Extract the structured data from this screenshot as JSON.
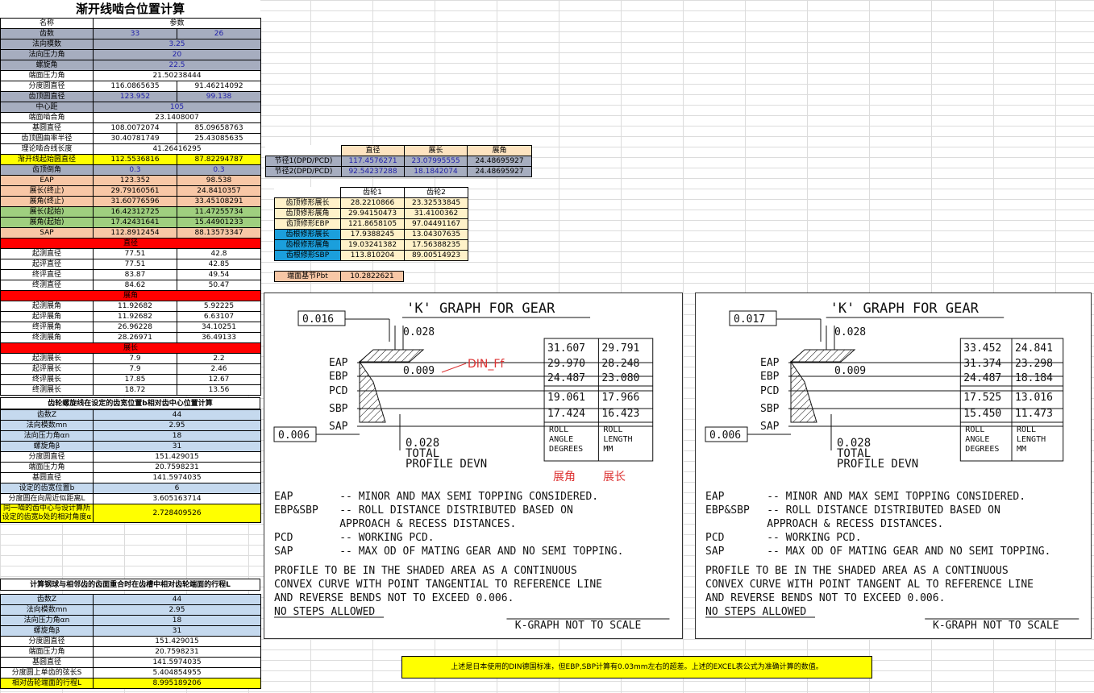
{
  "title": "渐开线啮合位置计算",
  "main_header": [
    "名称",
    "参数"
  ],
  "main_rows": [
    {
      "label": "齿数",
      "a": "33",
      "b": "26",
      "span": false,
      "style": "gray"
    },
    {
      "label": "法向模数",
      "v": "3.25",
      "span": true,
      "style": "gray"
    },
    {
      "label": "法向压力角",
      "v": "20",
      "span": true,
      "style": "gray"
    },
    {
      "label": "螺旋角",
      "v": "22.5",
      "span": true,
      "style": "gray"
    },
    {
      "label": "端面压力角",
      "v": "21.50238444",
      "span": true,
      "style": "white"
    },
    {
      "label": "分度圆直径",
      "a": "116.0865635",
      "b": "91.46214092",
      "span": false,
      "style": "white"
    },
    {
      "label": "齿顶圆直径",
      "a": "123.952",
      "b": "99.138",
      "span": false,
      "style": "gray"
    },
    {
      "label": "中心距",
      "v": "105",
      "span": true,
      "style": "gray"
    },
    {
      "label": "端面啮合角",
      "v": "23.1408007",
      "span": true,
      "style": "white"
    },
    {
      "label": "基圆直径",
      "a": "108.0072074",
      "b": "85.09658763",
      "span": false,
      "style": "white"
    },
    {
      "label": "齿顶圆曲率半径",
      "a": "30.40781749",
      "b": "25.43085635",
      "span": false,
      "style": "white"
    },
    {
      "label": "理论啮合线长度",
      "v": "41.26416295",
      "span": true,
      "style": "white"
    },
    {
      "label": "渐开线起始圆直径",
      "a": "112.5536816",
      "b": "87.82294787",
      "span": false,
      "style": "yellow"
    },
    {
      "label": "齿顶倒角",
      "a": "0.3",
      "b": "0.3",
      "span": false,
      "style": "gray"
    },
    {
      "label": "EAP",
      "a": "123.352",
      "b": "98.538",
      "span": false,
      "style": "orange"
    },
    {
      "label": "展长(终止)",
      "a": "29.79160561",
      "b": "24.8410357",
      "span": false,
      "style": "orange"
    },
    {
      "label": "展角(终止)",
      "a": "31.60776596",
      "b": "33.45108291",
      "span": false,
      "style": "orange"
    },
    {
      "label": "展长(起始)",
      "a": "16.42312725",
      "b": "11.47255734",
      "span": false,
      "style": "green"
    },
    {
      "label": "展角(起始)",
      "a": "17.42431641",
      "b": "15.44901233",
      "span": false,
      "style": "green"
    },
    {
      "label": "SAP",
      "a": "112.8912454",
      "b": "88.13573347",
      "span": false,
      "style": "orange"
    }
  ],
  "diameter_section": {
    "header": "直径",
    "rows": [
      {
        "label": "起测直径",
        "a": "77.51",
        "b": "42.8"
      },
      {
        "label": "起评直径",
        "a": "77.51",
        "b": "42.85"
      },
      {
        "label": "终评直径",
        "a": "83.87",
        "b": "49.54"
      },
      {
        "label": "终测直径",
        "a": "84.62",
        "b": "50.47"
      }
    ]
  },
  "angle_section": {
    "header": "展角",
    "rows": [
      {
        "label": "起测展角",
        "a": "11.92682",
        "b": "5.92225"
      },
      {
        "label": "起评展角",
        "a": "11.92682",
        "b": "6.63107"
      },
      {
        "label": "终评展角",
        "a": "26.96228",
        "b": "34.10251"
      },
      {
        "label": "终测展角",
        "a": "28.26971",
        "b": "36.49133"
      }
    ]
  },
  "length_section": {
    "header": "展长",
    "rows": [
      {
        "label": "起测展长",
        "a": "7.9",
        "b": "2.2"
      },
      {
        "label": "起评展长",
        "a": "7.9",
        "b": "2.46"
      },
      {
        "label": "终评展长",
        "a": "17.85",
        "b": "12.67"
      },
      {
        "label": "终测展长",
        "a": "18.72",
        "b": "13.56"
      }
    ]
  },
  "helix_section": {
    "title": "齿轮螺旋线在设定的齿宽位置b相对齿中心位置计算",
    "rows": [
      {
        "label": "齿数Z",
        "v": "44",
        "style": "blue"
      },
      {
        "label": "法向模数mn",
        "v": "2.95",
        "style": "blue"
      },
      {
        "label": "法向压力角αn",
        "v": "18",
        "style": "blue"
      },
      {
        "label": "螺旋角β",
        "v": "31",
        "style": "blue"
      },
      {
        "label": "分度圆直径",
        "v": "151.429015",
        "style": "white"
      },
      {
        "label": "端面压力角",
        "v": "20.7598231",
        "style": "white"
      },
      {
        "label": "基圆直径",
        "v": "141.5974035",
        "style": "white"
      },
      {
        "label": "设定的齿宽位置b",
        "v": "6",
        "style": "blue"
      },
      {
        "label": "分度圆在向周近似距离L",
        "v": "3.605163714",
        "style": "white"
      },
      {
        "label": "同一啮的齿中心与设计算所设定的齿宽b处的相对角度α",
        "v": "2.728409526",
        "style": "yellow"
      }
    ]
  },
  "travel_section": {
    "title": "计算钢球与相邻齿的齿面重合时在齿槽中相对齿轮端面的行程L",
    "rows": [
      {
        "label": "齿数Z",
        "v": "44",
        "style": "blue"
      },
      {
        "label": "法向模数mn",
        "v": "2.95",
        "style": "blue"
      },
      {
        "label": "法向压力角αn",
        "v": "18",
        "style": "blue"
      },
      {
        "label": "螺旋角β",
        "v": "31",
        "style": "blue"
      },
      {
        "label": "分度圆直径",
        "v": "151.429015",
        "style": "white"
      },
      {
        "label": "端面压力角",
        "v": "20.7598231",
        "style": "white"
      },
      {
        "label": "基圆直径",
        "v": "141.5974035",
        "style": "white"
      },
      {
        "label": "分度圆上单齿的弦长S",
        "v": "5.404854955",
        "style": "white"
      },
      {
        "label": "相对齿轮端面的行程L",
        "v": "8.995189206",
        "style": "yellow"
      }
    ]
  },
  "pitch_table": {
    "headers": [
      "",
      "直径",
      "展长",
      "展角"
    ],
    "rows": [
      {
        "label": "节径1(DPD/PCD)",
        "d": "117.4576271",
        "l": "23.07995555",
        "a": "24.48695927"
      },
      {
        "label": "节径2(DPD/PCD)",
        "d": "92.54237288",
        "l": "18.1842074",
        "a": "24.48695927"
      }
    ]
  },
  "mod_table": {
    "headers": [
      "",
      "齿轮1",
      "齿轮2"
    ],
    "rows": [
      {
        "label": "齿顶修形展长",
        "a": "28.2210866",
        "b": "23.32533845",
        "style": "pale"
      },
      {
        "label": "齿顶修形展角",
        "a": "29.94150473",
        "b": "31.4100362",
        "style": "pale"
      },
      {
        "label": "齿顶修形EBP",
        "a": "121.8658105",
        "b": "97.04491167",
        "style": "pale"
      },
      {
        "label": "齿根修形展长",
        "a": "17.9388245",
        "b": "13.04307635",
        "style": "cyan"
      },
      {
        "label": "齿根修形展角",
        "a": "19.03241382",
        "b": "17.56388235",
        "style": "cyan"
      },
      {
        "label": "齿根修形SBP",
        "a": "113.810204",
        "b": "89.00514923",
        "style": "cyan"
      }
    ]
  },
  "pbt": {
    "label": "端面基节Pbt",
    "v": "10.2822621"
  },
  "drawing1": {
    "title": "'K' GRAPH FOR GEAR",
    "tol_top": "0.016",
    "tol_028": "0.028",
    "tol_009": "0.009",
    "tol_bottom": "0.006",
    "din_label": "DIN_Ff",
    "points": [
      "EAP",
      "EBP",
      "PCD",
      "SBP",
      "SAP"
    ],
    "angles": [
      "31.607",
      "29.970",
      "24.487",
      "19.061",
      "17.424"
    ],
    "lengths": [
      "29.791",
      "28.248",
      "23.080",
      "17.966",
      "16.423"
    ],
    "col1_caption": [
      "ROLL",
      "ANGLE",
      "DEGREES"
    ],
    "col2_caption": [
      "ROLL",
      "LENGTH",
      "MM"
    ],
    "total_label": [
      "0.028",
      "TOTAL",
      "PROFILE DEVN"
    ],
    "cn_angle": "展角",
    "cn_length": "展长",
    "notes": [
      [
        "EAP",
        "-- MINOR AND MAX SEMI TOPPING CONSIDERED."
      ],
      [
        "EBP&SBP",
        "-- ROLL DISTANCE DISTRIBUTED BASED ON"
      ],
      [
        "",
        "APPROACH & RECESS DISTANCES."
      ],
      [
        "PCD",
        "-- WORKING PCD."
      ],
      [
        "SAP",
        "-- MAX OD OF MATING GEAR AND NO SEMI TOPPING."
      ]
    ],
    "profile_text": [
      "PROFILE TO BE IN THE SHADED AREA AS A CONTINUOUS",
      "CONVEX CURVE WITH POINT TANGENTIAL TO REFERENCE LINE",
      "AND REVERSE BENDS NOT TO EXCEED 0.006.",
      "NO STEPS ALLOWED"
    ],
    "scale": "K-GRAPH NOT TO SCALE"
  },
  "drawing2": {
    "title": "'K' GRAPH FOR GEAR",
    "tol_top": "0.017",
    "tol_028": "0.028",
    "tol_009": "0.009",
    "tol_bottom": "0.006",
    "points": [
      "EAP",
      "EBP",
      "PCD",
      "SBP",
      "SAP"
    ],
    "angles": [
      "33.452",
      "31.374",
      "24.487",
      "17.525",
      "15.450"
    ],
    "lengths": [
      "24.841",
      "23.298",
      "18.184",
      "13.016",
      "11.473"
    ],
    "col1_caption": [
      "ROLL",
      "ANGLE",
      "DEGREES"
    ],
    "col2_caption": [
      "ROLL",
      "LENGTH",
      "MM"
    ],
    "total_label": [
      "0.028",
      "TOTAL",
      "PROFILE DEVN"
    ],
    "notes": [
      [
        "EAP",
        "-- MINOR AND MAX SEMI TOPPING CONSIDERED."
      ],
      [
        "EBP&SBP",
        "-- ROLL DISTANCE DISTRIBUTED BASED ON"
      ],
      [
        "",
        "APPROACH & RECESS DISTANCES."
      ],
      [
        "PCD",
        "-- WORKING PCD."
      ],
      [
        "SAP",
        "-- MAX OD OF MATING GEAR AND NO SEMI TOPPING."
      ]
    ],
    "profile_text": [
      "PROFILE TO BE IN THE SHADED AREA AS A CONTINUOUS",
      "CONVEX CURVE WITH POINT TANGENT AL TO REFERENCE LINE",
      "AND REVERSE BENDS NOT TO EXCEED 0.006.",
      "NO STEPS ALLOWED"
    ],
    "scale": "K-GRAPH NOT TO SCALE"
  },
  "note": "上述是日本使用的DIN德国标准，但EBP,SBP计算有0.03mm左右的超差。上述的EXCEL表公式为准确计算的数值。",
  "colors": {
    "gray": "#a6adbf",
    "yellow": "#ffff00",
    "orange": "#f8c7a6",
    "green": "#9fcf7f",
    "red": "#ff0000",
    "cyan": "#1b9fdc",
    "pale": "#fff2c9",
    "lightblue": "#c5d9ee"
  }
}
